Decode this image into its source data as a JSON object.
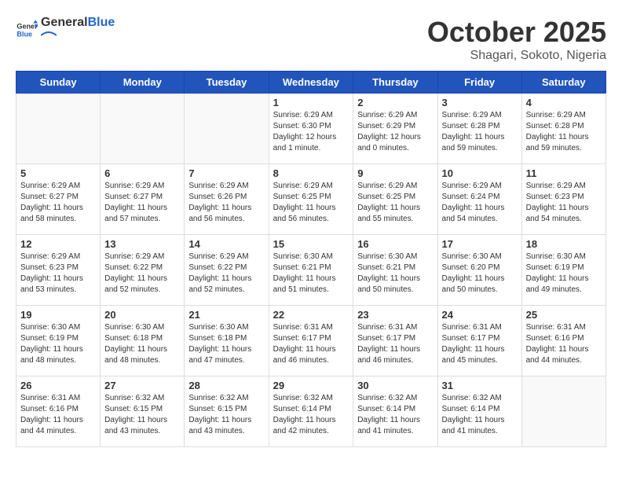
{
  "header": {
    "logo_text_general": "General",
    "logo_text_blue": "Blue",
    "month_title": "October 2025",
    "location": "Shagari, Sokoto, Nigeria"
  },
  "weekdays": [
    "Sunday",
    "Monday",
    "Tuesday",
    "Wednesday",
    "Thursday",
    "Friday",
    "Saturday"
  ],
  "weeks": [
    [
      {
        "day": "",
        "info": ""
      },
      {
        "day": "",
        "info": ""
      },
      {
        "day": "",
        "info": ""
      },
      {
        "day": "1",
        "info": "Sunrise: 6:29 AM\nSunset: 6:30 PM\nDaylight: 12 hours\nand 1 minute."
      },
      {
        "day": "2",
        "info": "Sunrise: 6:29 AM\nSunset: 6:29 PM\nDaylight: 12 hours\nand 0 minutes."
      },
      {
        "day": "3",
        "info": "Sunrise: 6:29 AM\nSunset: 6:28 PM\nDaylight: 11 hours\nand 59 minutes."
      },
      {
        "day": "4",
        "info": "Sunrise: 6:29 AM\nSunset: 6:28 PM\nDaylight: 11 hours\nand 59 minutes."
      }
    ],
    [
      {
        "day": "5",
        "info": "Sunrise: 6:29 AM\nSunset: 6:27 PM\nDaylight: 11 hours\nand 58 minutes."
      },
      {
        "day": "6",
        "info": "Sunrise: 6:29 AM\nSunset: 6:27 PM\nDaylight: 11 hours\nand 57 minutes."
      },
      {
        "day": "7",
        "info": "Sunrise: 6:29 AM\nSunset: 6:26 PM\nDaylight: 11 hours\nand 56 minutes."
      },
      {
        "day": "8",
        "info": "Sunrise: 6:29 AM\nSunset: 6:25 PM\nDaylight: 11 hours\nand 56 minutes."
      },
      {
        "day": "9",
        "info": "Sunrise: 6:29 AM\nSunset: 6:25 PM\nDaylight: 11 hours\nand 55 minutes."
      },
      {
        "day": "10",
        "info": "Sunrise: 6:29 AM\nSunset: 6:24 PM\nDaylight: 11 hours\nand 54 minutes."
      },
      {
        "day": "11",
        "info": "Sunrise: 6:29 AM\nSunset: 6:23 PM\nDaylight: 11 hours\nand 54 minutes."
      }
    ],
    [
      {
        "day": "12",
        "info": "Sunrise: 6:29 AM\nSunset: 6:23 PM\nDaylight: 11 hours\nand 53 minutes."
      },
      {
        "day": "13",
        "info": "Sunrise: 6:29 AM\nSunset: 6:22 PM\nDaylight: 11 hours\nand 52 minutes."
      },
      {
        "day": "14",
        "info": "Sunrise: 6:29 AM\nSunset: 6:22 PM\nDaylight: 11 hours\nand 52 minutes."
      },
      {
        "day": "15",
        "info": "Sunrise: 6:30 AM\nSunset: 6:21 PM\nDaylight: 11 hours\nand 51 minutes."
      },
      {
        "day": "16",
        "info": "Sunrise: 6:30 AM\nSunset: 6:21 PM\nDaylight: 11 hours\nand 50 minutes."
      },
      {
        "day": "17",
        "info": "Sunrise: 6:30 AM\nSunset: 6:20 PM\nDaylight: 11 hours\nand 50 minutes."
      },
      {
        "day": "18",
        "info": "Sunrise: 6:30 AM\nSunset: 6:19 PM\nDaylight: 11 hours\nand 49 minutes."
      }
    ],
    [
      {
        "day": "19",
        "info": "Sunrise: 6:30 AM\nSunset: 6:19 PM\nDaylight: 11 hours\nand 48 minutes."
      },
      {
        "day": "20",
        "info": "Sunrise: 6:30 AM\nSunset: 6:18 PM\nDaylight: 11 hours\nand 48 minutes."
      },
      {
        "day": "21",
        "info": "Sunrise: 6:30 AM\nSunset: 6:18 PM\nDaylight: 11 hours\nand 47 minutes."
      },
      {
        "day": "22",
        "info": "Sunrise: 6:31 AM\nSunset: 6:17 PM\nDaylight: 11 hours\nand 46 minutes."
      },
      {
        "day": "23",
        "info": "Sunrise: 6:31 AM\nSunset: 6:17 PM\nDaylight: 11 hours\nand 46 minutes."
      },
      {
        "day": "24",
        "info": "Sunrise: 6:31 AM\nSunset: 6:17 PM\nDaylight: 11 hours\nand 45 minutes."
      },
      {
        "day": "25",
        "info": "Sunrise: 6:31 AM\nSunset: 6:16 PM\nDaylight: 11 hours\nand 44 minutes."
      }
    ],
    [
      {
        "day": "26",
        "info": "Sunrise: 6:31 AM\nSunset: 6:16 PM\nDaylight: 11 hours\nand 44 minutes."
      },
      {
        "day": "27",
        "info": "Sunrise: 6:32 AM\nSunset: 6:15 PM\nDaylight: 11 hours\nand 43 minutes."
      },
      {
        "day": "28",
        "info": "Sunrise: 6:32 AM\nSunset: 6:15 PM\nDaylight: 11 hours\nand 43 minutes."
      },
      {
        "day": "29",
        "info": "Sunrise: 6:32 AM\nSunset: 6:14 PM\nDaylight: 11 hours\nand 42 minutes."
      },
      {
        "day": "30",
        "info": "Sunrise: 6:32 AM\nSunset: 6:14 PM\nDaylight: 11 hours\nand 41 minutes."
      },
      {
        "day": "31",
        "info": "Sunrise: 6:32 AM\nSunset: 6:14 PM\nDaylight: 11 hours\nand 41 minutes."
      },
      {
        "day": "",
        "info": ""
      }
    ]
  ]
}
